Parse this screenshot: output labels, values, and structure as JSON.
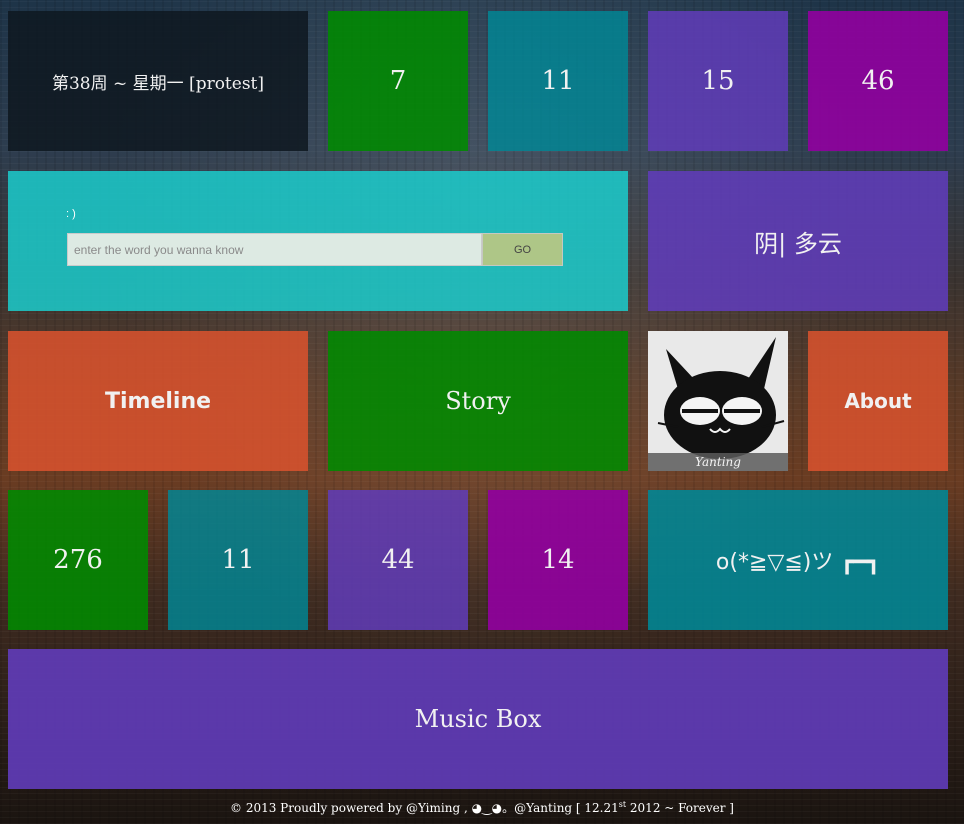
{
  "header_row": {
    "date_text": "第38周 ~ 星期一 [protest]",
    "tiles": [
      "7",
      "11",
      "15",
      "46"
    ]
  },
  "search": {
    "label": ": )",
    "placeholder": "enter the word you wanna know",
    "value": "",
    "go_label": "GO"
  },
  "weather": "阴| 多云",
  "nav": {
    "timeline": "Timeline",
    "story": "Story",
    "about": "About"
  },
  "avatar": {
    "caption": "Yanting"
  },
  "stats_row": {
    "tiles": [
      "276",
      "11",
      "44",
      "14"
    ],
    "emoticon": "o(*≧▽≦)ツ ┏━┓"
  },
  "music_box": "Music Box",
  "footer": {
    "prefix": "© 2013 Proudly powered by @Yiming , ◕‿◕。@Yanting [ 12.21",
    "sup": "st",
    "suffix": " 2012 ~ Forever ]"
  },
  "colors": {
    "green": "#008a00",
    "teal": "#008796",
    "purple": "#603cba",
    "magenta": "#9100a0",
    "orange": "#d7522d",
    "cyan": "#1bcdcd",
    "dark": "#0e1820"
  }
}
